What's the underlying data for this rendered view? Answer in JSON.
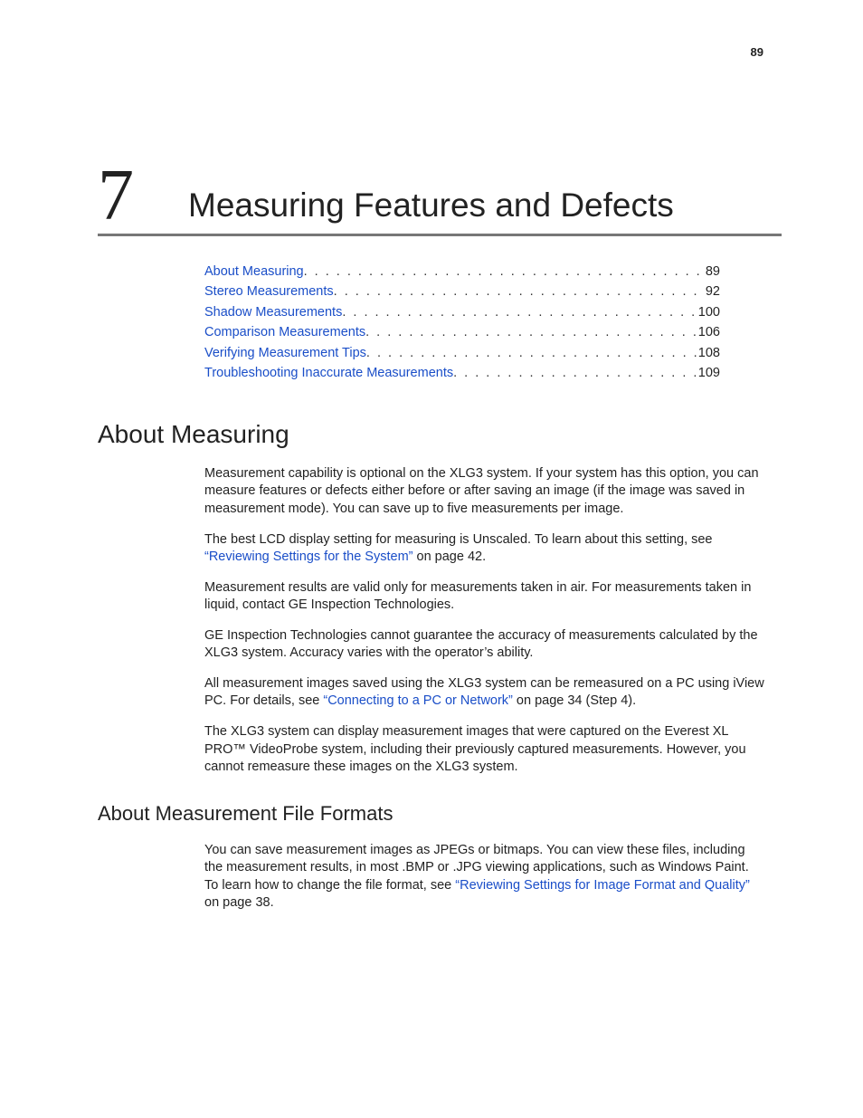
{
  "page_number": "89",
  "chapter": {
    "number": "7",
    "title": "Measuring Features and Defects"
  },
  "toc": [
    {
      "label": "About Measuring",
      "page": "89"
    },
    {
      "label": "Stereo Measurements",
      "page": "92"
    },
    {
      "label": "Shadow Measurements",
      "page": "100"
    },
    {
      "label": "Comparison Measurements",
      "page": "106"
    },
    {
      "label": "Verifying Measurement Tips",
      "page": "108"
    },
    {
      "label": "Troubleshooting Inaccurate Measurements",
      "page": "109"
    }
  ],
  "section1": {
    "heading": "About Measuring",
    "p1": "Measurement capability is optional on the XLG3 system. If your system has this option, you can measure features or defects either before or after saving an image (if the image was saved in measurement mode). You can save up to five measurements per image.",
    "p2a": "The best LCD display setting for measuring is Unscaled. To learn about this setting, see ",
    "p2link": "“Reviewing Settings for the System”",
    "p2b": " on page 42.",
    "p3": "Measurement results are valid only for measurements taken in air. For measurements taken in liquid, contact GE Inspection Technologies.",
    "p4": "GE Inspection Technologies cannot guarantee the accuracy of measurements calculated by the XLG3 system. Accuracy varies with the operator’s ability.",
    "p5a": "All measurement images saved using the XLG3 system can be remeasured on a PC using iView PC. For details, see ",
    "p5link": "“Connecting to a PC or Network”",
    "p5b": " on page 34 (Step 4).",
    "p6": "The XLG3 system can display measurement images that were captured on the Everest XL PRO™ VideoProbe system, including their previously captured measurements. However, you cannot remeasure these images on the XLG3 system."
  },
  "section2": {
    "heading": "About Measurement File Formats",
    "p1a": "You can save measurement images as JPEGs or bitmaps. You can view these files, including the measurement results, in most .BMP or .JPG viewing applications, such as Windows Paint. To learn how to change the file format, see ",
    "p1link": "“Reviewing Settings for Image Format and Quality”",
    "p1b": " on page 38."
  }
}
